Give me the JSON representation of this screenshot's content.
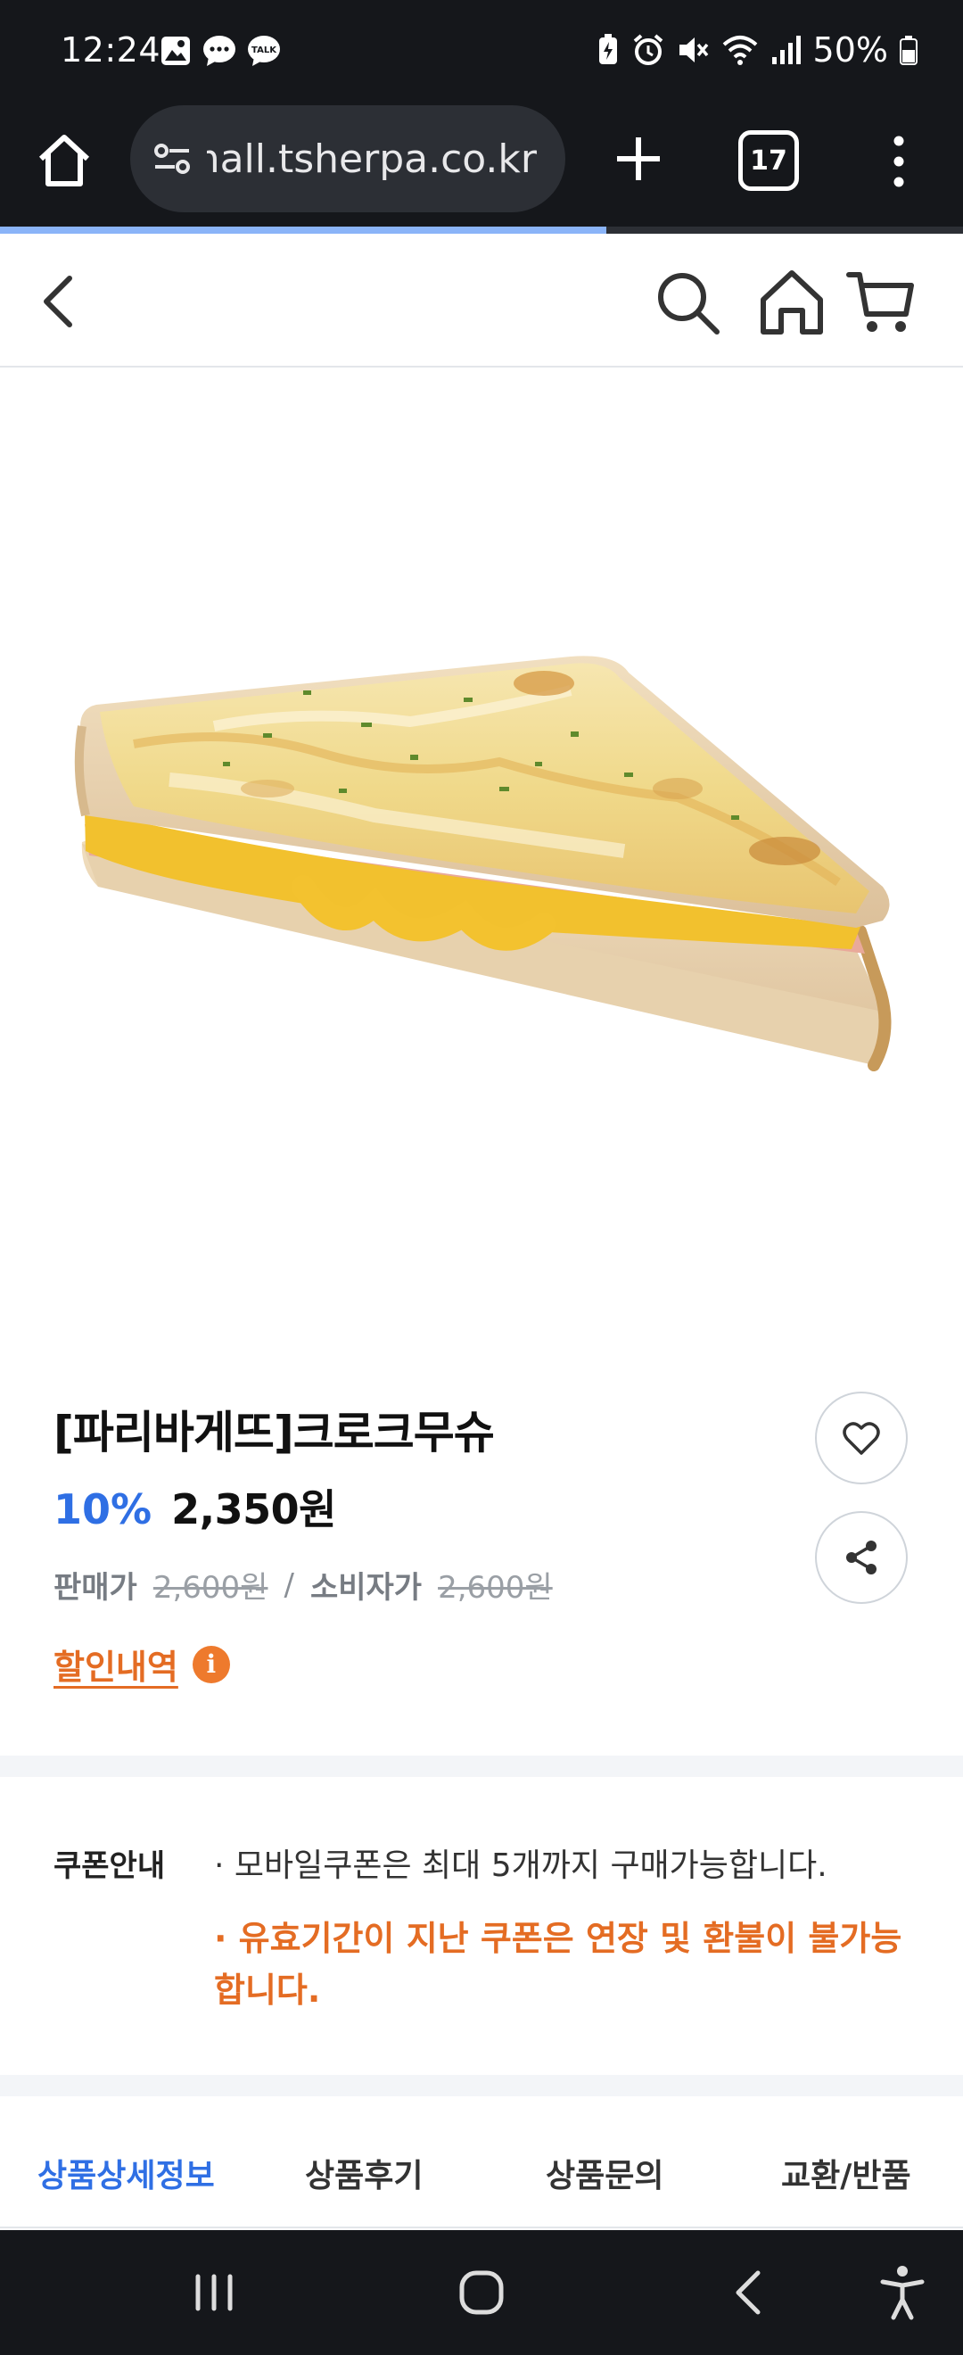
{
  "status_bar": {
    "time": "12:24",
    "battery": "50%",
    "left_icons": [
      "gallery-icon",
      "chat-bubble-icon",
      "talk-icon"
    ],
    "right_icons": [
      "battery-saver-icon",
      "alarm-icon",
      "mute-icon",
      "wifi-icon",
      "signal-icon",
      "battery-icon"
    ]
  },
  "browser": {
    "url": "mall.tsherpa.co.kr",
    "tab_count": "17",
    "load_progress": 0.63
  },
  "product": {
    "title": "[파리바게뜨]크로크무슈",
    "discount": "10%",
    "price": "2,350원",
    "sale_label": "판매가",
    "sale_price": "2,600원",
    "separator": "/",
    "consumer_label": "소비자가",
    "consumer_price": "2,600원",
    "discount_history": "할인내역",
    "info_mark": "i"
  },
  "coupon": {
    "label": "쿠폰안내",
    "line1": "· 모바일쿠폰은 최대 5개까지 구매가능합니다.",
    "line2": "· 유효기간이 지난 쿠폰은 연장 및 환불이 불가능합니다."
  },
  "tabs": [
    {
      "label": "상품상세정보",
      "active": true
    },
    {
      "label": "상품후기",
      "active": false
    },
    {
      "label": "상품문의",
      "active": false
    },
    {
      "label": "교환/반품",
      "active": false
    }
  ],
  "colors": {
    "accent_blue": "#2f6fe4",
    "accent_orange": "#e46c23",
    "system_bar": "#15171b"
  }
}
